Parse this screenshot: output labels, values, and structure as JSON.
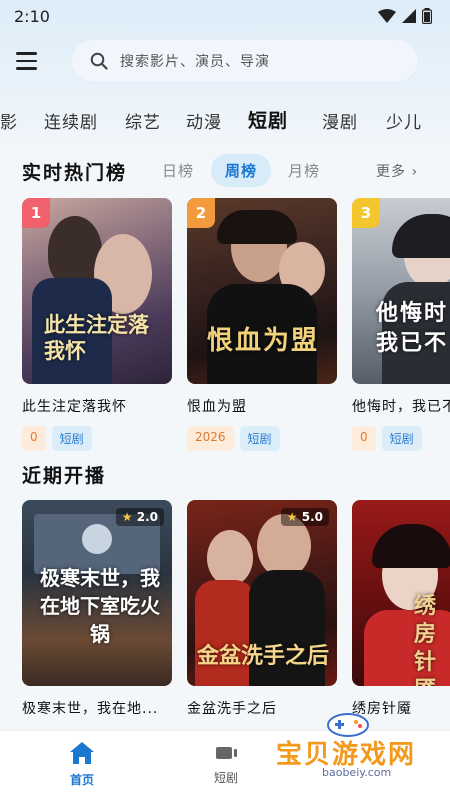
{
  "status_bar": {
    "time": "2:10"
  },
  "search": {
    "placeholder": "搜索影片、演员、导演"
  },
  "categories": [
    "影",
    "连续剧",
    "综艺",
    "动漫",
    "短剧",
    "漫剧",
    "少儿"
  ],
  "active_category": "短剧",
  "hot": {
    "title": "实时热门榜",
    "tabs": [
      "日榜",
      "周榜",
      "月榜"
    ],
    "active_tab": "周榜",
    "more": "更多",
    "items": [
      {
        "rank": "1",
        "title": "此生注定落我怀",
        "poster_text": "此生注定落我怀",
        "tags": [
          "0",
          "短剧"
        ],
        "rank_color": "#f0606d"
      },
      {
        "rank": "2",
        "title": "恨血为盟",
        "poster_text": "恨血为盟",
        "tags": [
          "2026",
          "短剧"
        ],
        "rank_color": "#f39a3c"
      },
      {
        "rank": "3",
        "title": "他悔时，我已不",
        "poster_text": "他悔时我已不",
        "tags": [
          "0",
          "短剧"
        ],
        "rank_color": "#f4c62d"
      }
    ]
  },
  "recent": {
    "title": "近期开播",
    "items": [
      {
        "title": "极寒末世，我在地...",
        "poster_text": "极寒末世，我在地下室吃火锅",
        "rating": "2.0"
      },
      {
        "title": "金盆洗手之后",
        "poster_text": "金盆洗手之后",
        "rating": "5.0"
      },
      {
        "title": "绣房针魇",
        "poster_text": "绣房针魇",
        "rating": ""
      }
    ]
  },
  "bottom_nav": {
    "items": [
      {
        "label": "首页",
        "icon": "home-icon",
        "active": true
      },
      {
        "label": "短剧",
        "icon": "shorts-icon",
        "active": false
      }
    ]
  },
  "watermark": {
    "name": "宝贝游戏网",
    "url": "baobeiy.com"
  },
  "colors": {
    "accent": "#1a77d2",
    "tab_active_bg": "#d8ebf8",
    "tag_orange": "#e07a2a",
    "tag_blue": "#2b7ccd"
  }
}
